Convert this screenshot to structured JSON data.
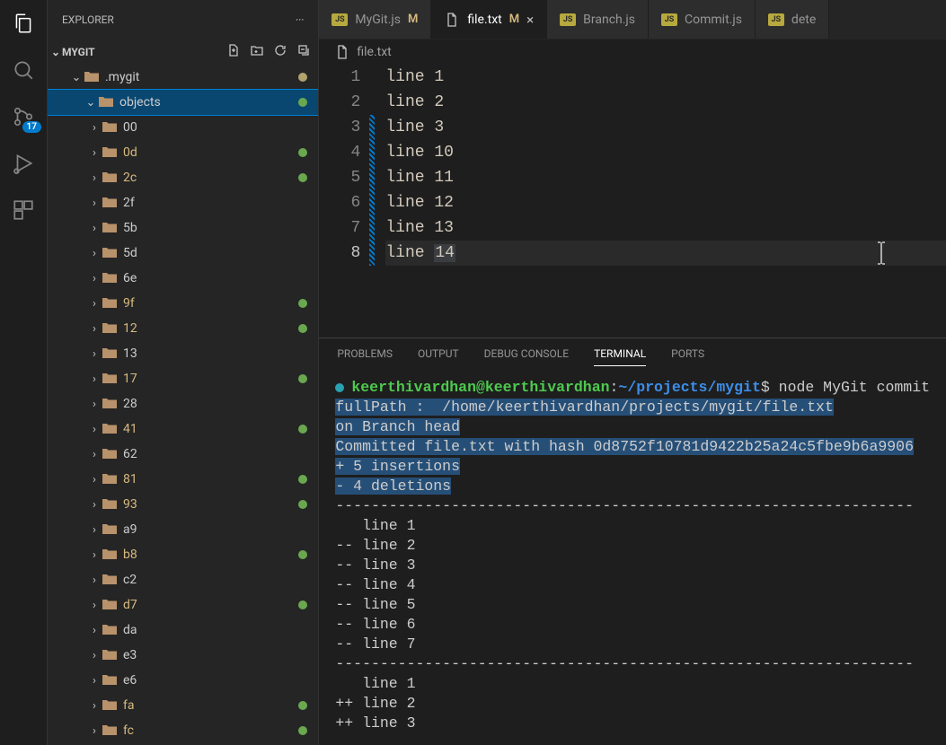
{
  "activity": {
    "scm_badge": "17"
  },
  "sidebar": {
    "title": "EXPLORER",
    "root": "MYGIT",
    "tree": [
      {
        "name": ".mygit",
        "depth": 2,
        "expanded": true,
        "dot": "beige"
      },
      {
        "name": "objects",
        "depth": 3,
        "expanded": true,
        "selected": true,
        "dot": "green"
      },
      {
        "name": "00",
        "depth": 4
      },
      {
        "name": "0d",
        "depth": 4,
        "dot": "green",
        "modified": true
      },
      {
        "name": "2c",
        "depth": 4,
        "dot": "green",
        "modified": true
      },
      {
        "name": "2f",
        "depth": 4
      },
      {
        "name": "5b",
        "depth": 4
      },
      {
        "name": "5d",
        "depth": 4
      },
      {
        "name": "6e",
        "depth": 4
      },
      {
        "name": "9f",
        "depth": 4,
        "dot": "green",
        "modified": true
      },
      {
        "name": "12",
        "depth": 4,
        "dot": "green",
        "modified": true
      },
      {
        "name": "13",
        "depth": 4
      },
      {
        "name": "17",
        "depth": 4,
        "dot": "green",
        "modified": true
      },
      {
        "name": "28",
        "depth": 4
      },
      {
        "name": "41",
        "depth": 4,
        "dot": "green",
        "modified": true
      },
      {
        "name": "62",
        "depth": 4
      },
      {
        "name": "81",
        "depth": 4,
        "dot": "green",
        "modified": true
      },
      {
        "name": "93",
        "depth": 4,
        "dot": "green",
        "modified": true
      },
      {
        "name": "a9",
        "depth": 4
      },
      {
        "name": "b8",
        "depth": 4,
        "dot": "green",
        "modified": true
      },
      {
        "name": "c2",
        "depth": 4
      },
      {
        "name": "d7",
        "depth": 4,
        "dot": "green",
        "modified": true
      },
      {
        "name": "da",
        "depth": 4
      },
      {
        "name": "e3",
        "depth": 4
      },
      {
        "name": "e6",
        "depth": 4
      },
      {
        "name": "fa",
        "depth": 4,
        "dot": "green",
        "modified": true
      },
      {
        "name": "fc",
        "depth": 4,
        "dot": "green",
        "modified": true
      }
    ]
  },
  "tabs": [
    {
      "label": "MyGit.js",
      "type": "js",
      "mod": "M"
    },
    {
      "label": "file.txt",
      "type": "file",
      "mod": "M",
      "active": true,
      "close": true
    },
    {
      "label": "Branch.js",
      "type": "js"
    },
    {
      "label": "Commit.js",
      "type": "js"
    },
    {
      "label": "dete",
      "type": "js",
      "partial": true
    }
  ],
  "breadcrumb": {
    "file": "file.txt"
  },
  "editor": {
    "lines": [
      {
        "n": 1,
        "text": "line 1"
      },
      {
        "n": 2,
        "text": "line 2"
      },
      {
        "n": 3,
        "text": "line 3",
        "changed": true
      },
      {
        "n": 4,
        "text": "line 10",
        "changed": true
      },
      {
        "n": 5,
        "text": "line 11",
        "changed": true
      },
      {
        "n": 6,
        "text": "line 12",
        "changed": true
      },
      {
        "n": 7,
        "text": "line 13",
        "changed": true
      },
      {
        "n": 8,
        "text": "line ",
        "suffix": "14",
        "current": true,
        "changed": true
      }
    ]
  },
  "panel": {
    "tabs": [
      "PROBLEMS",
      "OUTPUT",
      "DEBUG CONSOLE",
      "TERMINAL",
      "PORTS"
    ],
    "active": "TERMINAL"
  },
  "terminal": {
    "prompt_user": "keerthivardhan@keerthivardhan",
    "prompt_sep": ":",
    "prompt_path": "~/projects/mygit",
    "prompt_sym": "$ ",
    "command": "node MyGit commit",
    "out": [
      "fullPath :  /home/keerthivardhan/projects/mygit/file.txt",
      "on Branch head",
      "Committed file.txt with hash 0d8752f10781d9422b25a24c5fbe9b6a9906",
      "+ 5 insertions",
      "- 4 deletions"
    ],
    "rest": [
      "-----------------------------------------------------------------",
      "   line 1",
      "-- line 2",
      "-- line 3",
      "-- line 4",
      "-- line 5",
      "-- line 6",
      "-- line 7",
      "-----------------------------------------------------------------",
      "   line 1",
      "++ line 2",
      "++ line 3"
    ]
  }
}
